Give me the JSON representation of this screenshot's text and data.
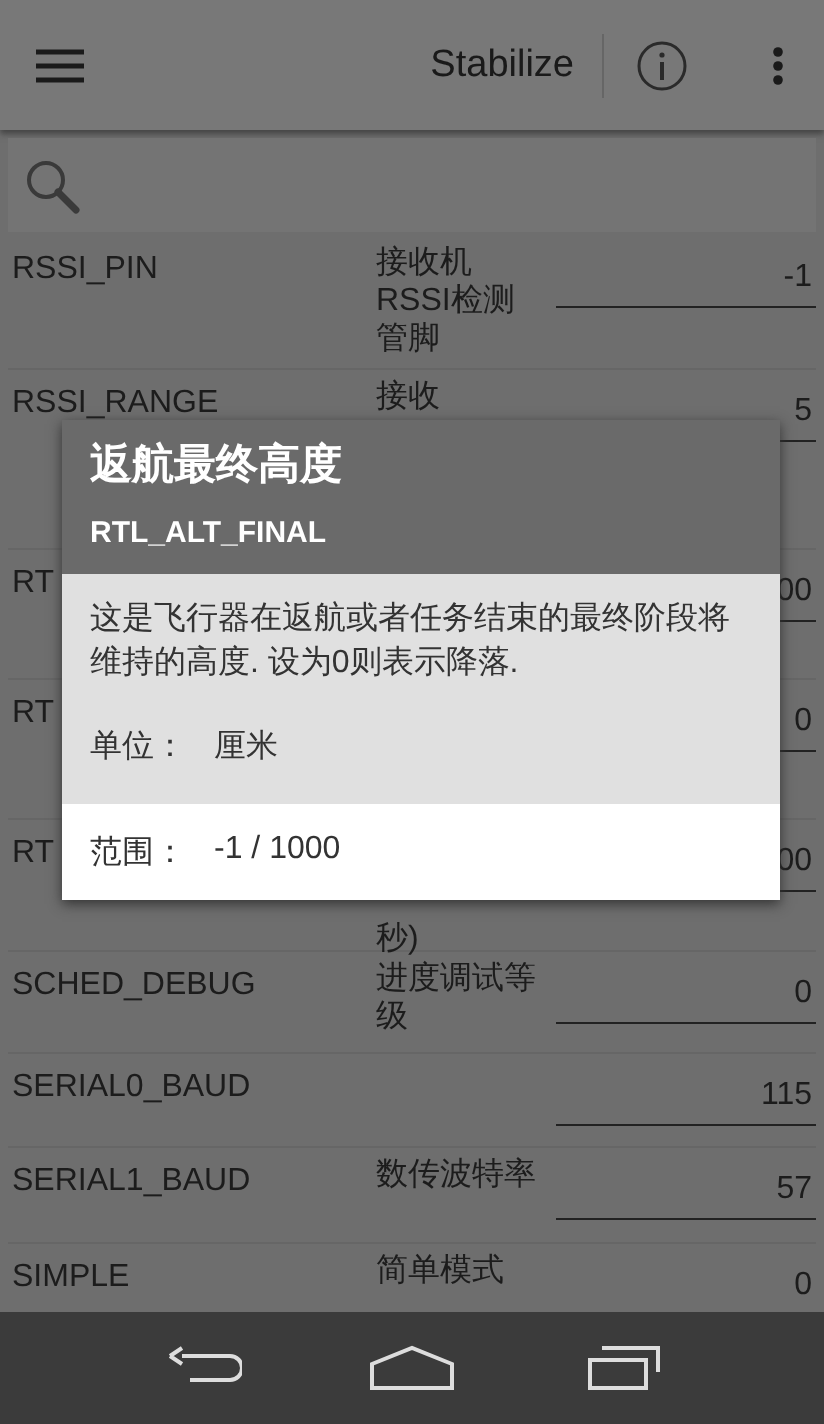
{
  "app_bar": {
    "title": "Stabilize"
  },
  "parameters": [
    {
      "name": "RSSI_PIN",
      "description": "接收机RSSI检测管脚",
      "value": "-1"
    },
    {
      "name": "RSSI_RANGE",
      "description": "接收",
      "value": "5"
    },
    {
      "name": "RT",
      "value": "00"
    },
    {
      "name": "RT",
      "value": "0"
    },
    {
      "name": "RT",
      "description": "秒)",
      "value": "00"
    },
    {
      "name": "SCHED_DEBUG",
      "description": "进度调试等级",
      "value": "0"
    },
    {
      "name": "SERIAL0_BAUD",
      "value": "115"
    },
    {
      "name": "SERIAL1_BAUD",
      "description": "数传波特率",
      "value": "57"
    },
    {
      "name": "SIMPLE",
      "description": "简单模式",
      "value": "0"
    }
  ],
  "dialog": {
    "title": "返航最终高度",
    "param": "RTL_ALT_FINAL",
    "description": "这是飞行器在返航或者任务结束的最终阶段将维持的高度. 设为0则表示降落.",
    "unit_label": "单位：",
    "unit": "厘米",
    "range_label": "范围：",
    "range": "-1 / 1000"
  }
}
